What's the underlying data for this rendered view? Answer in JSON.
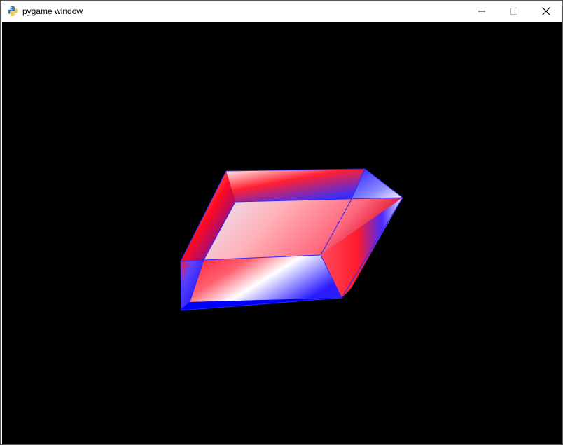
{
  "window": {
    "title": "pygame window",
    "app_icon": "python-icon",
    "controls": {
      "minimize": "minimize-icon",
      "maximize": "maximize-icon",
      "close": "close-icon"
    }
  },
  "scene": {
    "background": "#000000",
    "object": "rotating-3d-box",
    "colors": {
      "primary": "#0000ff",
      "secondary": "#ff0000",
      "highlight": "#ffffff"
    }
  }
}
